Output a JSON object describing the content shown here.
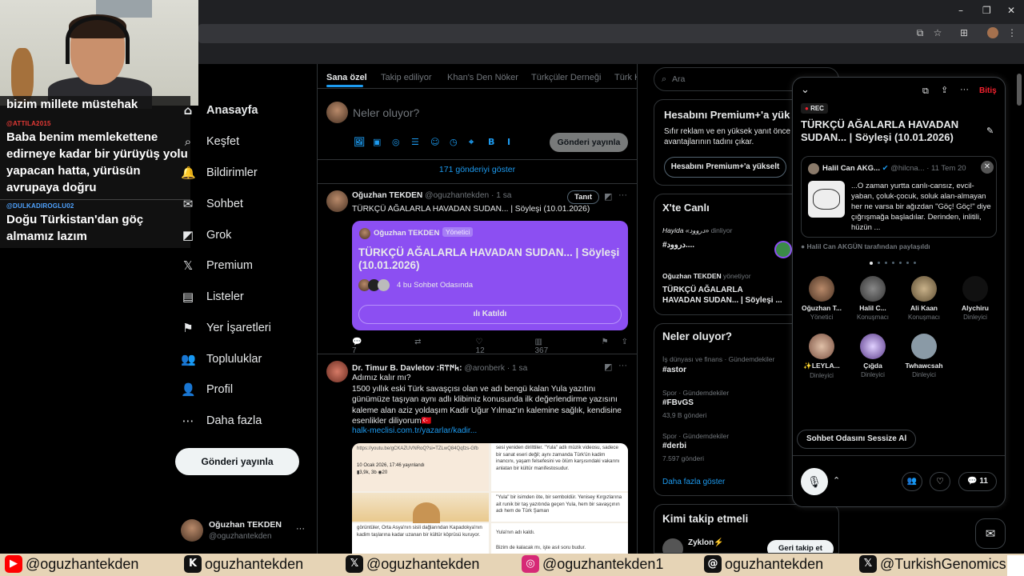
{
  "window": {
    "minimize": "–",
    "maximize": "❐",
    "close": "✕"
  },
  "chat": [
    {
      "name": "",
      "text": "bizim millete müstehak"
    },
    {
      "name": "@ATTILA2015",
      "name_color": "#e53935",
      "text": "Baba benim memlekettene edirneye kadar bir yürüyüş yolu yapacan hatta, yürüsün avrupaya doğru"
    },
    {
      "name": "@DULKADIROGLU02",
      "name_color": "#4fa3ff",
      "text": "Doğu Türkistan'dan göç almamız lazım"
    }
  ],
  "nav": [
    {
      "label": "Anasayfa",
      "icon": "home-icon",
      "glyph": "⌂",
      "active": true
    },
    {
      "label": "Keşfet",
      "icon": "search-icon",
      "glyph": "⌕"
    },
    {
      "label": "Bildirimler",
      "icon": "bell-icon",
      "glyph": "🔔"
    },
    {
      "label": "Sohbet",
      "icon": "mail-icon",
      "glyph": "✉"
    },
    {
      "label": "Grok",
      "icon": "grok-icon",
      "glyph": "◩"
    },
    {
      "label": "Premium",
      "icon": "x-logo-icon",
      "glyph": "𝕏"
    },
    {
      "label": "Listeler",
      "icon": "list-icon",
      "glyph": "▤"
    },
    {
      "label": "Yer İşaretleri",
      "icon": "bookmark-icon",
      "glyph": "⚑"
    },
    {
      "label": "Topluluklar",
      "icon": "communities-icon",
      "glyph": "👥"
    },
    {
      "label": "Profil",
      "icon": "profile-icon",
      "glyph": "👤"
    },
    {
      "label": "Daha fazla",
      "icon": "more-icon",
      "glyph": "⋯"
    }
  ],
  "post_button": "Gönderi yayınla",
  "account": {
    "name": "Oğuzhan TEKDEN",
    "handle": "@oguzhantekden",
    "more": "···"
  },
  "tabs": [
    "Sana özel",
    "Takip ediliyor",
    "Khan's Den Nöker",
    "Türkçüler Derneği",
    "Türk K"
  ],
  "composer": {
    "placeholder": "Neler oluyor?",
    "submit": "Gönderi yayınla",
    "tools": [
      "🖼",
      "▣",
      "◎",
      "☰",
      "☺",
      "◷",
      "⌖",
      "B",
      "I"
    ]
  },
  "show_more": "171 gönderiyi göster",
  "posts": [
    {
      "name": "Oğuzhan TEKDEN",
      "handle": "@oguzhantekden · 1 sa",
      "text": "TÜRKÇÜ AĞALARLA HAVADAN SUDAN... | Söyleşi (10.01.2026)",
      "badge": "Tanıt",
      "space": {
        "host": "Oğuzhan TEKDEN",
        "role": "Yönetici",
        "title": "TÜRKÇÜ AĞALARLA HAVADAN SUDAN... | Söyleşi (10.01.2026)",
        "listeners": "4 bu Sohbet Odasında",
        "button": "Katıldı"
      },
      "stats": {
        "replies": "7",
        "reposts": "",
        "likes": "12",
        "views": "367"
      }
    },
    {
      "name": "Dr. Timur B. Davletov :𐱅𐰇𐰼𐰜:",
      "handle": "@aronberk · 1 sa",
      "text": "Adımız kalır mı?\n1500 yıllık eski Türk savaşçısı olan ve adı bengü kalan Yula yazıtını günümüze taşıyan aynı adlı klibimiz konusunda ilk değerlendirme yazısını kaleme alan aziz yoldaşım Kadir Uğur Yılmaz'ın kalemine sağlık, kendisine esenlikler diliyorum🇹🇷",
      "link": "halk-meclisi.com.tr/yazarlar/kadir...",
      "image": {
        "url_line": "https://youtu.be/gCKAZUVNRoQ?si=TZLwQ84Qqfzs-Gfb",
        "date_line": "10 Ocak 2026, 17:46 yayınlandı",
        "stats_line": "▮3,9k, 3b  ◉20",
        "right_top": "sesi yeniden dirilttiler. \"Yula\" adlı müzik videosu, sadece bir sanat eseri değil; aynı zamanda Türk'ün kadim inancını, yaşam felsefesini ve ölüm karşısındaki vakarını anlatan bir kültür manifestosudur.",
        "right_mid": "\"Yula\" bir isimden öte, bir semboldür. Yenisey Kırgızlarına ait runik bir taş yazıtında geçen Yula, hem bir savaşçının adı hem de Türk Şaman",
        "left_bottom": "görüntüler, Orta Asya'nın sisli dağlarından Kapadokya'nın kadim taşlarına kadar uzanan bir kültür köprüsü kuruyor.",
        "right_bottom1": "Yula'nın adı kaldı.",
        "right_bottom2": "Bizim de kalacak mı, işte asıl soru budur."
      }
    }
  ],
  "right": {
    "search_placeholder": "Ara",
    "premium": {
      "title": "Hesabını Premium+'a yük",
      "desc": "Sıfır reklam ve en yüksek yanıt önce avantajlarının tadını çıkar.",
      "button": "Hesabını Premium+'a yükselt"
    },
    "live": {
      "title": "X'te Canlı",
      "items": [
        {
          "user": "Hayida «دروود»",
          "status": "dinliyor",
          "title": "#دروود...."
        },
        {
          "user": "Oğuzhan TEKDEN",
          "status": "yönetiyor",
          "title": "TÜRKÇÜ AĞALARLA HAVADAN SUDAN... | Söyleşi ..."
        }
      ]
    },
    "trends": {
      "title": "Neler oluyor?",
      "items": [
        {
          "cat": "İş dünyası ve finans · Gündemdekiler",
          "tag": "#astor",
          "count": ""
        },
        {
          "cat": "Spor · Gündemdekiler",
          "tag": "#FBvGS",
          "count": "43,9 B gönderi"
        },
        {
          "cat": "Spor · Gündemdekiler",
          "tag": "#derbi",
          "count": "7.597 gönderi"
        }
      ],
      "more": "Daha fazla göster"
    },
    "follow": {
      "title": "Kimi takip etmeli",
      "name": "Zyklon⚡",
      "button": "Geri takip et"
    }
  },
  "spaces": {
    "leave": "Bitiş",
    "rec": "REC",
    "title": "TÜRKÇÜ AĞALARLA HAVADAN SUDAN... | Söyleşi (10.01.2026)",
    "pinned": {
      "name": "Halil Can AKG...",
      "handle": "@hilcna...",
      "date": "· 11 Tem 20",
      "text": "...O zaman yurtta canlı-cansız, evcil-yaban, çoluk-çocuk, soluk alan-almayan her ne varsa bir ağızdan \"Göç! Göç!\" diye çığrışmağa başladılar. Derinden, inlitili, hüzün ...",
      "shared": "Halil Can AKGÜN tarafından paylaşıldı"
    },
    "users": [
      {
        "name": "Oğuzhan T...",
        "role": "Yönetici"
      },
      {
        "name": "Halil C...",
        "role": "Konuşmacı"
      },
      {
        "name": "Ali Kaan",
        "role": "Konuşmacı"
      },
      {
        "name": "Alychiru",
        "role": "Dinleyici"
      },
      {
        "name": "✨LEYLA...",
        "role": "Dinleyici"
      },
      {
        "name": "Çığda",
        "role": "Dinleyici"
      },
      {
        "name": "Twhawcsah",
        "role": "Dinleyici"
      }
    ],
    "mute_all": "Sohbet Odasını Sessize Al",
    "comments": "11"
  },
  "footer": [
    {
      "icon": "youtube-icon",
      "glyph": "▶",
      "color": "#ff0000",
      "label": "@oguzhantekden"
    },
    {
      "icon": "kick-icon",
      "glyph": "K",
      "color": "#111111",
      "label": "oguzhantekden"
    },
    {
      "icon": "x-icon",
      "glyph": "𝕏",
      "color": "#111111",
      "label": "@oguzhantekden"
    },
    {
      "icon": "instagram-icon",
      "glyph": "◎",
      "color": "#d62976",
      "label": "@oguzhantekden1"
    },
    {
      "icon": "threads-icon",
      "glyph": "@",
      "color": "#111111",
      "label": "oguzhantekden"
    },
    {
      "icon": "x-icon",
      "glyph": "𝕏",
      "color": "#111111",
      "label": "@TurkishGenomics"
    }
  ]
}
